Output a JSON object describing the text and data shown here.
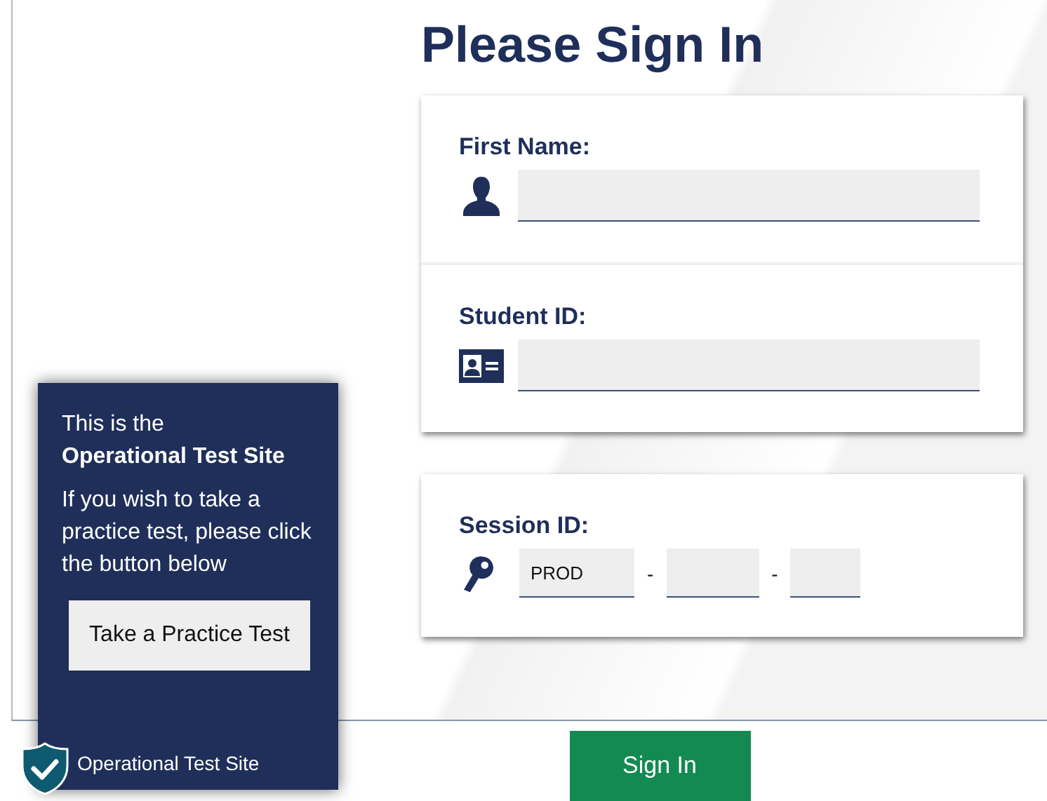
{
  "title": "Please Sign In",
  "fields": [
    {
      "kind": "person",
      "label": "First Name:"
    },
    {
      "kind": "card",
      "label": "Student ID:"
    }
  ],
  "session": {
    "label": "Session ID:",
    "segments": [
      {
        "kind": "long",
        "value": "PROD"
      },
      {
        "kind": "medium"
      },
      {
        "kind": "short"
      }
    ],
    "separators": [
      "-",
      "-"
    ]
  },
  "sign_in_button": "Sign In",
  "site_panel": {
    "intro": "This is the",
    "site_name": "Operational Test Site",
    "message": "If you wish to take a practice test, please click the button below",
    "button": "Take a Practice Test",
    "badge_label": "Operational Test Site"
  }
}
